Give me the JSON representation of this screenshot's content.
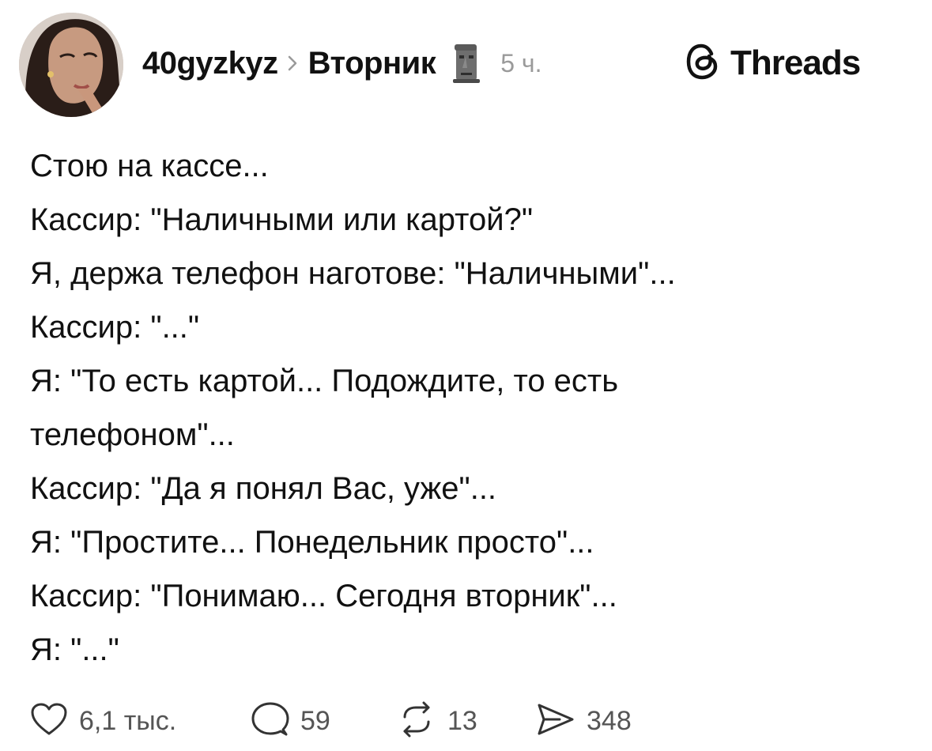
{
  "post": {
    "author": {
      "username": "40gyzkyz",
      "avatar_icon": "profile-photo"
    },
    "topic": "Вторник",
    "topic_emoji_icon": "moai-icon",
    "time": "5 ч.",
    "brand": {
      "name": "Threads",
      "icon": "threads-logo-icon"
    },
    "lines": [
      "Стою на кассе...",
      "Кассир: \"Наличными или картой?\"",
      "Я, держа телефон наготове: \"Наличными\"...",
      "Кассир: \"...\"",
      "Я: \"То есть картой... Подождите, то есть",
      "телефоном\"...",
      "Кассир: \"Да я понял Вас, уже\"...",
      "Я: \"Простите... Понедельник просто\"...",
      "Кассир: \"Понимаю... Сегодня вторник\"...",
      "Я: \"...\""
    ],
    "actions": {
      "likes": "6,1 тыс.",
      "replies": "59",
      "reposts": "13",
      "shares": "348"
    }
  },
  "colors": {
    "text": "#111111",
    "muted": "#9a9a9a",
    "counts": "#555555",
    "background": "#ffffff"
  }
}
